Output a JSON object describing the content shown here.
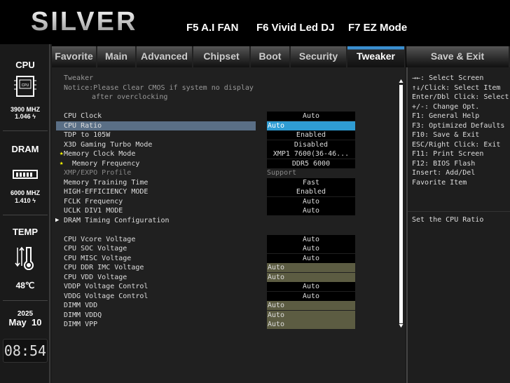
{
  "header": {
    "logo": "SILVER",
    "fkeys": [
      "F5 A.I FAN",
      "F6 Vivid Led DJ",
      "F7 EZ Mode"
    ]
  },
  "sidebar": {
    "cpu_title": "CPU",
    "cpu_freq": "3900 MHZ",
    "cpu_volt": "1.046 ϟ",
    "dram_title": "DRAM",
    "dram_freq": "6000 MHZ",
    "dram_volt": "1.410 ϟ",
    "temp_title": "TEMP",
    "temp_value": "48℃",
    "year": "2025",
    "date": "May  10",
    "time": "08:54"
  },
  "tabs": [
    {
      "label": "Favorite"
    },
    {
      "label": "Main"
    },
    {
      "label": "Advanced"
    },
    {
      "label": "Chipset"
    },
    {
      "label": "Boot"
    },
    {
      "label": "Security"
    },
    {
      "label": "Tweaker",
      "active": true
    },
    {
      "label": "Save & Exit"
    }
  ],
  "content": {
    "section": "Tweaker",
    "notice_1": "Notice:Please Clear CMOS if system no display",
    "notice_2": "after overclocking",
    "rows": [
      {
        "label": "CPU Clock",
        "value": "Auto",
        "style": "box"
      },
      {
        "label": "CPU Ratio",
        "value": "Auto",
        "style": "blue",
        "selected": true
      },
      {
        "label": "TDP to 105W",
        "value": "Enabled",
        "style": "box"
      },
      {
        "label": "X3D Gaming Turbo Mode",
        "value": "Disabled",
        "style": "box"
      },
      {
        "label": "Memory Clock Mode",
        "value": "XMP1 7600(36-46...",
        "style": "box",
        "star": true
      },
      {
        "label": "  Memory Frequency",
        "value": "DDR5 6000",
        "style": "box",
        "star": true
      },
      {
        "label": "XMP/EXPO Profile",
        "value": "Support",
        "style": "plain",
        "dim": true
      },
      {
        "label": "Memory Training Time",
        "value": "Fast",
        "style": "box"
      },
      {
        "label": "HIGH-EFFICIENCY MODE",
        "value": "Enabled",
        "style": "box"
      },
      {
        "label": "FCLK Frequency",
        "value": "Auto",
        "style": "box"
      },
      {
        "label": "UCLK DIV1 MODE",
        "value": "Auto",
        "style": "box"
      },
      {
        "label": "DRAM Timing Configuration",
        "submenu": true
      },
      null,
      {
        "label": "CPU Vcore Voltage",
        "value": "Auto",
        "style": "box"
      },
      {
        "label": "CPU SOC Voltage",
        "value": "Auto",
        "style": "box"
      },
      {
        "label": "CPU MISC Voltage",
        "value": "Auto",
        "style": "box"
      },
      {
        "label": "CPU DDR IMC Voltage",
        "value": "Auto",
        "style": "olive"
      },
      {
        "label": "CPU VDD Voltage",
        "value": "Auto",
        "style": "olive"
      },
      {
        "label": "VDDP Voltage Control",
        "value": "Auto",
        "style": "box"
      },
      {
        "label": "VDDG Voltage Control",
        "value": "Auto",
        "style": "box"
      },
      {
        "label": "DIMM VDD",
        "value": "Auto",
        "style": "olive"
      },
      {
        "label": "DIMM VDDQ",
        "value": "Auto",
        "style": "olive"
      },
      {
        "label": "DIMM VPP",
        "value": "Auto",
        "style": "olive"
      }
    ]
  },
  "help": {
    "lines": [
      "→←: Select Screen",
      "↑↓/Click: Select Item",
      "Enter/Dbl Click: Select",
      "+/-: Change Opt.",
      "F1: General Help",
      "F3: Optimized Defaults",
      "F10: Save & Exit",
      "ESC/Right Click: Exit",
      "F11: Print Screen",
      "F12: BIOS Flash",
      "Insert: Add/Del",
      "Favorite Item"
    ],
    "description": "Set the CPU Ratio"
  },
  "colors": {
    "accent": "#2f9cd3",
    "olive": "#5c5c42",
    "selected_row": "#5a6f86"
  }
}
